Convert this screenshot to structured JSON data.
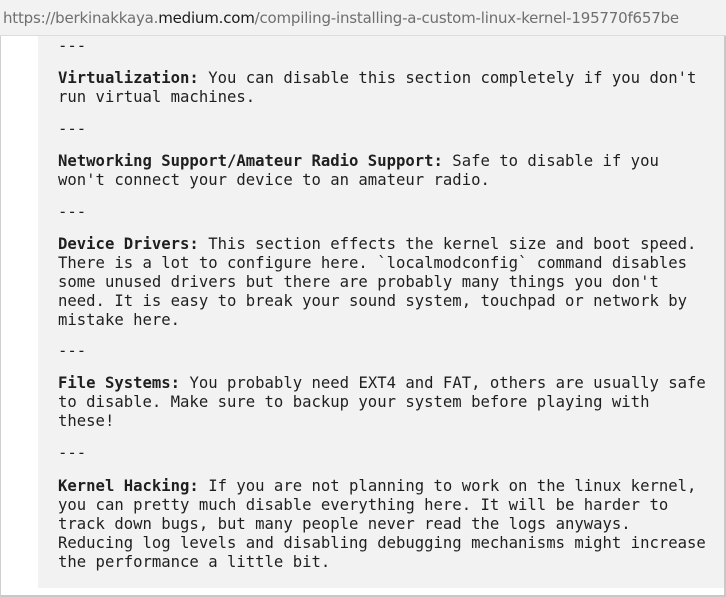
{
  "browser": {
    "url_prefix": "https://berkinakkaya.",
    "url_domain": "medium.com",
    "url_path": "/compiling-installing-a-custom-linux-kernel-195770f657be"
  },
  "article": {
    "separator": "---",
    "sections": [
      {
        "heading": "Virtualization:",
        "body": " You can disable this section completely if you don't\nrun virtual machines."
      },
      {
        "heading": "Networking Support/Amateur Radio Support:",
        "body": " Safe to disable if you\nwon't connect your device to an amateur radio."
      },
      {
        "heading": "Device Drivers:",
        "body": " This section effects the kernel size and boot speed.\nThere is a lot to configure here. `localmodconfig` command disables\nsome unused drivers but there are probably many things you don't\nneed. It is easy to break your sound system, touchpad or network by\nmistake here."
      },
      {
        "heading": "File Systems:",
        "body": " You probably need EXT4 and FAT, others are usually safe\nto disable. Make sure to backup your system before playing with\nthese!"
      },
      {
        "heading": "Kernel Hacking:",
        "body": " If you are not planning to work on the linux kernel,\nyou can pretty much disable everything here. It will be harder to\ntrack down bugs, but many people never read the logs anyways.\nReducing log levels and disabling debugging mechanisms might increase\nthe performance a little bit."
      }
    ]
  }
}
